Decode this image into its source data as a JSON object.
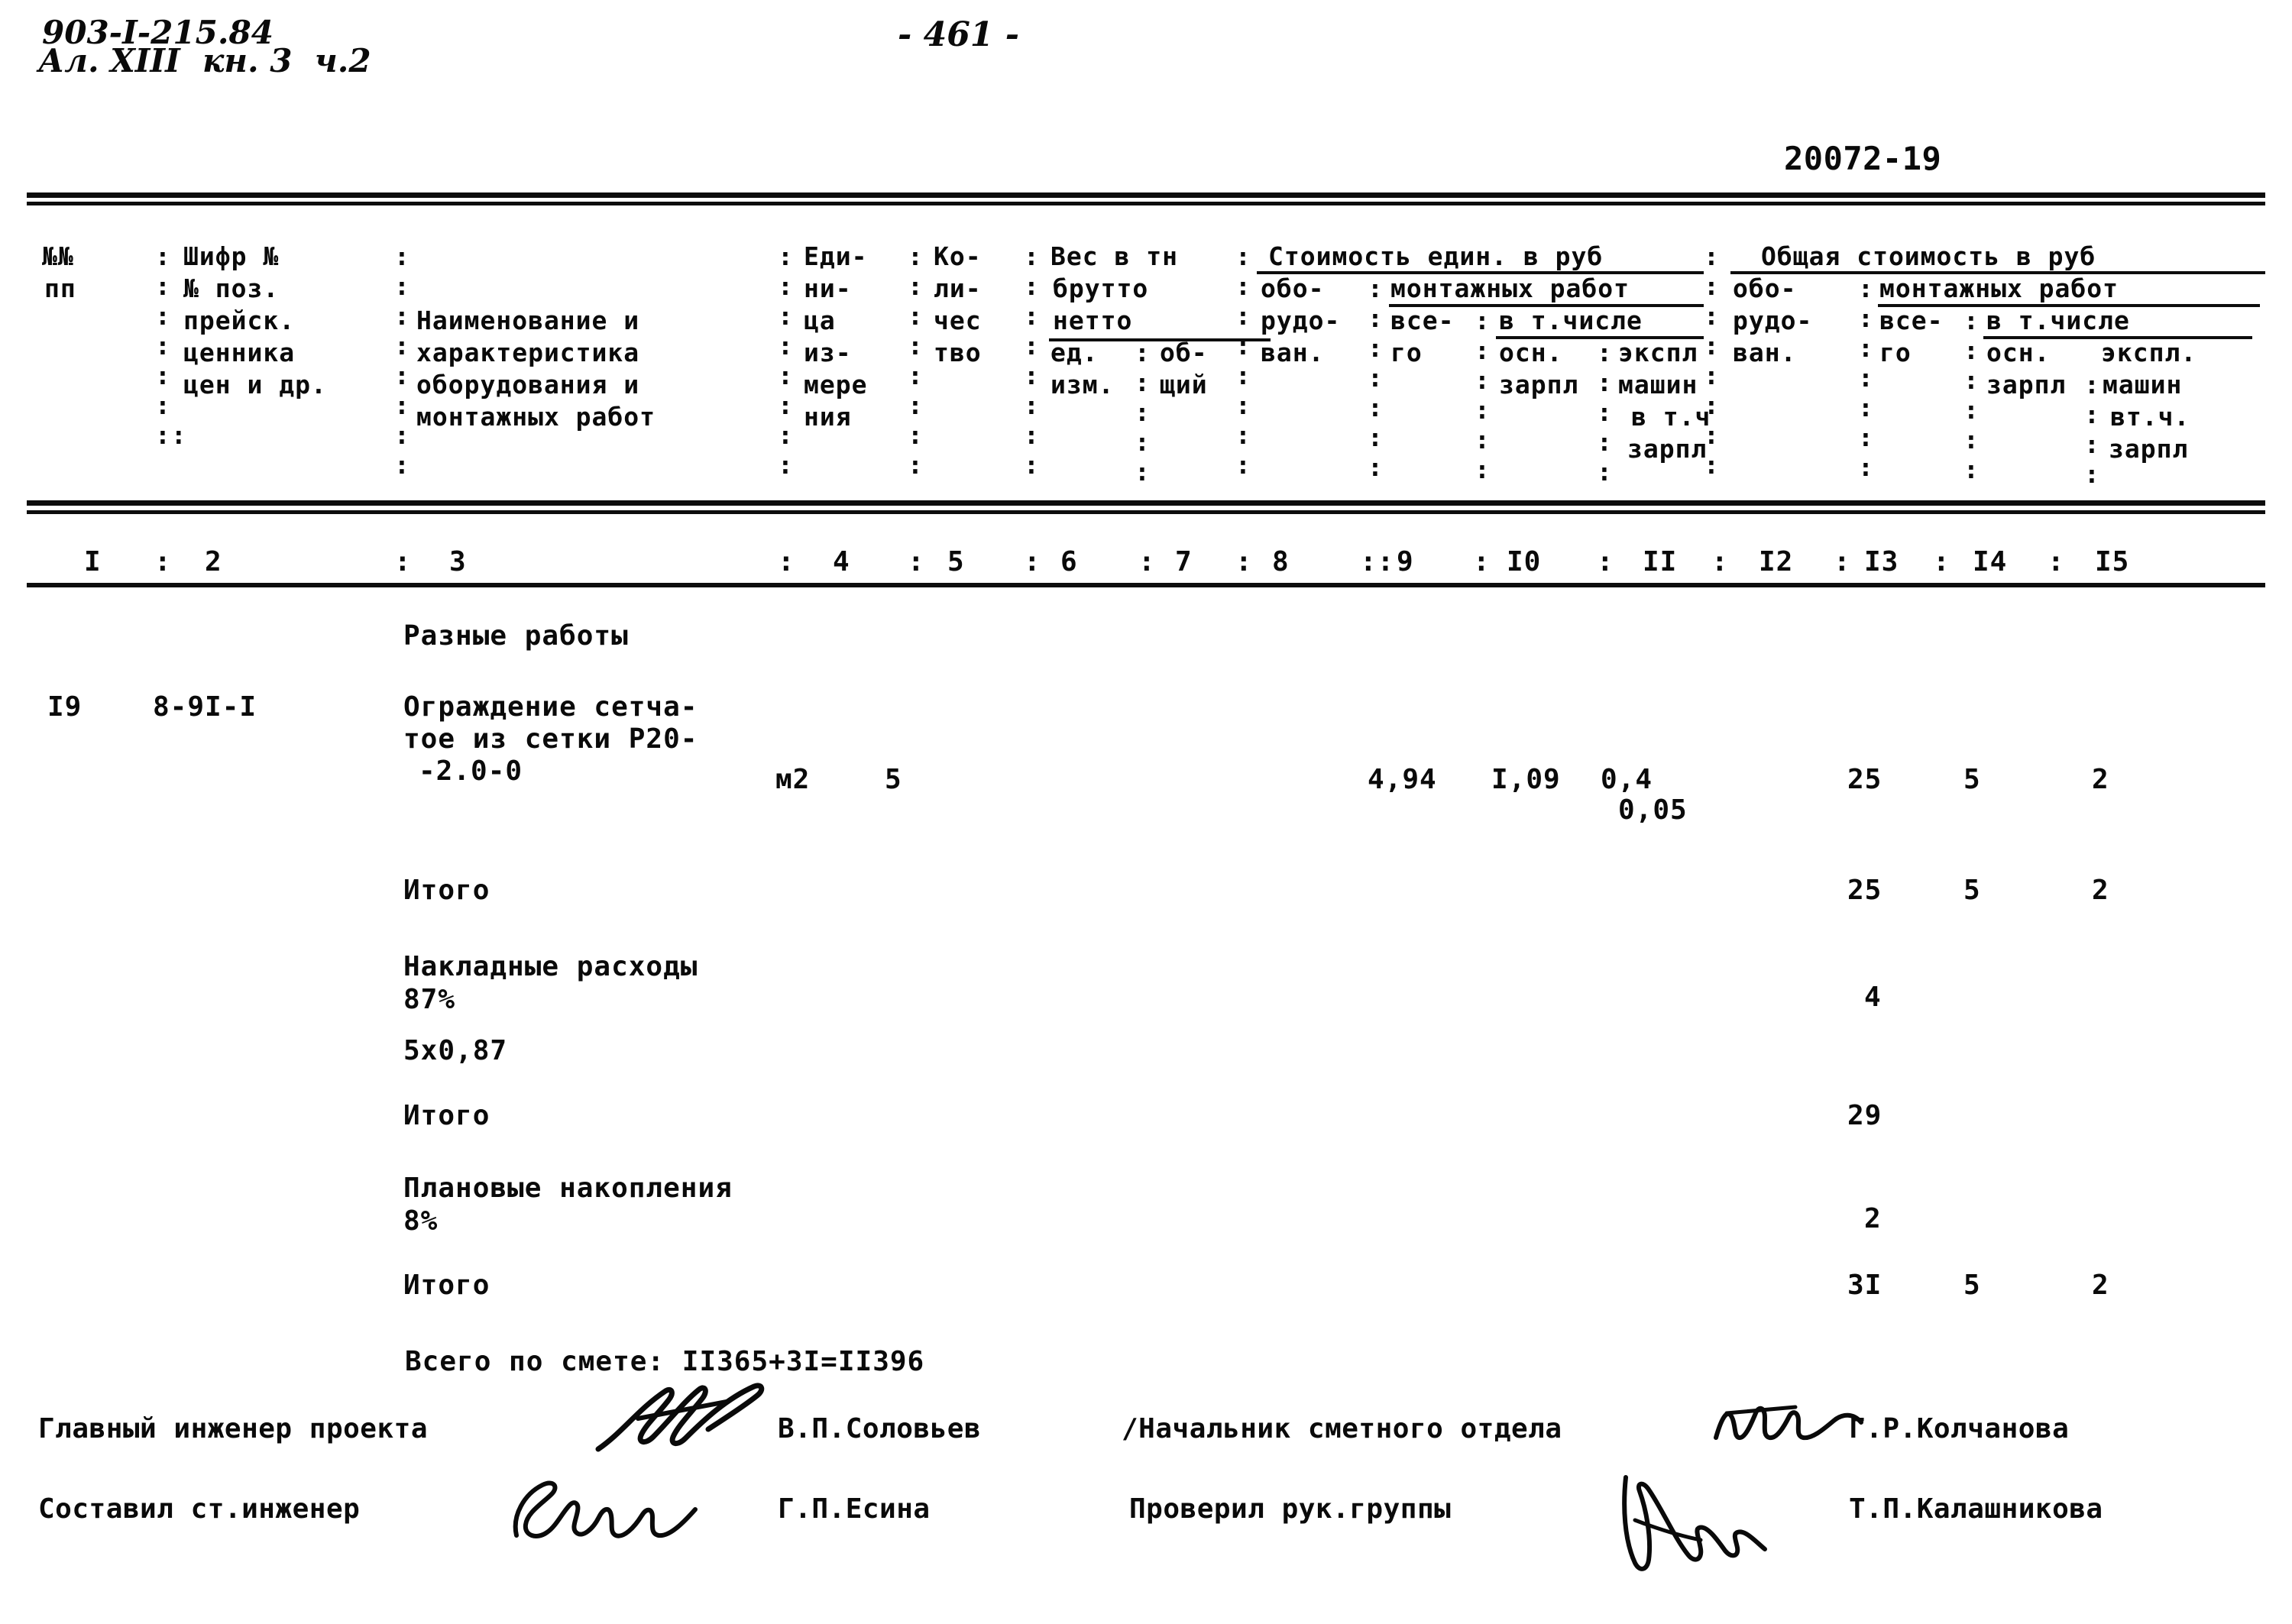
{
  "document": {
    "doc_code": "903-I-215.84",
    "album_line": "Ал. XIII  кн. 3  ч.2",
    "page_marker": "- 461 -",
    "sheet_code": "20072-19"
  },
  "table": {
    "header_col1": [
      "№№",
      "пп"
    ],
    "header_col2": [
      "Шифр №",
      "№ поз.",
      "прейск.",
      "ценника",
      "цен и др."
    ],
    "header_col3": [
      "Наименование и",
      "характеристика",
      "оборудования и",
      "монтажных работ"
    ],
    "header_col4": [
      "Еди-",
      "ни-",
      "ца",
      "из-",
      "мере",
      "ния"
    ],
    "header_col5": [
      "Ко-",
      "ли-",
      "чес",
      "тво"
    ],
    "header_weight_group": "Вес в тн",
    "header_weight_brutto": "брутто",
    "header_weight_netto": "нетто",
    "header_col6": [
      "ед.",
      "изм."
    ],
    "header_col7": [
      "об-",
      "щий"
    ],
    "header_unit_group": "Стоимость един. в руб",
    "header_total_group": "Общая стоимость в руб",
    "header_equipment": [
      "обо-",
      "рудо-",
      "ван."
    ],
    "header_mount_works": "монтажных работ",
    "header_all": [
      "все-",
      "го"
    ],
    "header_included": "в т.числе",
    "header_osn_zarpl": [
      "осн.",
      "зарпл"
    ],
    "header_expl_mash": [
      "экспл",
      "машин",
      "в т.ч",
      "зарпл"
    ],
    "header_equipment2": [
      "обо-",
      "рудо-",
      "ван."
    ],
    "header_all2": [
      "все-",
      "го"
    ],
    "header_osn_zarpl2": [
      "осн.",
      "зарпл"
    ],
    "header_expl_mash2": [
      "экспл.",
      "машин",
      "вт.ч.",
      "зарпл"
    ],
    "column_numbers": [
      "I",
      "2",
      "3",
      "4",
      "5",
      "6",
      "7",
      "8",
      "9",
      "I0",
      "II",
      "I2",
      "I3",
      "I4",
      "I5"
    ]
  },
  "body": {
    "section_title": "Разные работы",
    "row": {
      "pp": "I9",
      "code": "8-9I-I",
      "name_line1": "Ограждение сетча-",
      "name_line2": "тое из сетки Р20-",
      "name_line3": "-2.0-0",
      "unit": "м2",
      "qty": "5",
      "col9": "4,94",
      "col10": "I,09",
      "col11_main": "0,4",
      "col11_sub": "0,05",
      "col13": "25",
      "col14": "5",
      "col15": "2"
    },
    "subtotal1": {
      "label": "Итого",
      "col13": "25",
      "col14": "5",
      "col15": "2"
    },
    "overhead": {
      "label": "Накладные расходы",
      "percent": "87%",
      "formula": "5х0,87",
      "col13": "4"
    },
    "subtotal2": {
      "label": "Итого",
      "col13": "29"
    },
    "profit": {
      "label": "Плановые накопления",
      "percent": "8%",
      "col13": "2"
    },
    "subtotal3": {
      "label": "Итого",
      "col13": "3I",
      "col14": "5",
      "col15": "2"
    },
    "grand_total": "Всего по смете: II365+3I=II396"
  },
  "signatures": {
    "left": [
      {
        "role": "Главный инженер проекта",
        "name": "В.П.Соловьев"
      },
      {
        "role": "Составил ст.инженер",
        "name": "Г.П.Есина"
      }
    ],
    "right": [
      {
        "role": "/Начальник сметного отдела",
        "name": "Г.Р.Колчанова"
      },
      {
        "role": "Проверил рук.группы",
        "name": "Т.П.Калашникова"
      }
    ]
  }
}
